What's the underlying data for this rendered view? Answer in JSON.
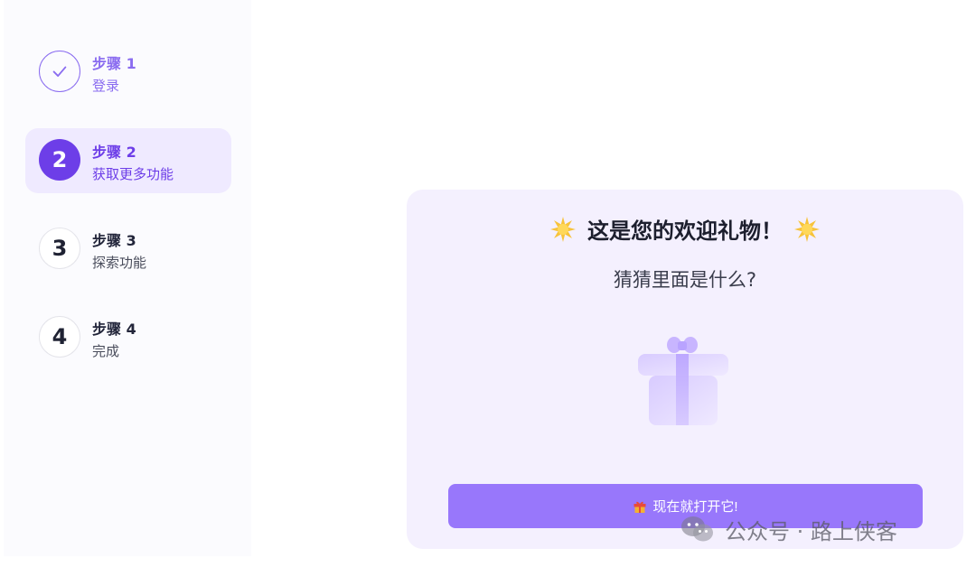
{
  "steps": [
    {
      "title": "步骤 1",
      "subtitle": "登录",
      "state": "done",
      "number": "1",
      "icon": "check-icon"
    },
    {
      "title": "步骤 2",
      "subtitle": "获取更多功能",
      "state": "active",
      "number": "2"
    },
    {
      "title": "步骤 3",
      "subtitle": "探索功能",
      "state": "pending",
      "number": "3"
    },
    {
      "title": "步骤 4",
      "subtitle": "完成",
      "state": "pending",
      "number": "4"
    }
  ],
  "gift_card": {
    "title": "这是您的欢迎礼物！",
    "subtitle": "猜猜里面是什么?",
    "button_label": "现在就打开它!",
    "sparkle_icon": "sparkle-icon",
    "gift_icon": "gift-box-icon",
    "button_icon": "gift-emoji-icon"
  },
  "watermark": {
    "text": "公众号 · 路上侠客",
    "icon": "wechat-icon"
  },
  "colors": {
    "accent": "#6d3ee8",
    "accent_light": "#8a6cf0",
    "button": "#9877fb",
    "card_bg": "#f4f0fe",
    "active_step_bg": "#efeaff",
    "sparkle": "#f7c33b"
  }
}
